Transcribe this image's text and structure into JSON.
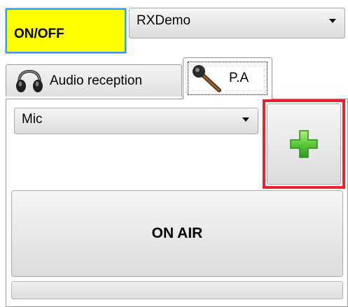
{
  "toolbar": {
    "onoff_label": "ON/OFF",
    "onoff_color": "#ffff00",
    "device_selected": "RXDemo"
  },
  "tabs": [
    {
      "label": "Audio reception",
      "icon": "headphones-icon",
      "active": false
    },
    {
      "label": "P.A",
      "icon": "microphone-icon",
      "active": true
    }
  ],
  "pa": {
    "source_selected": "Mic",
    "add_button_icon": "plus-icon",
    "add_highlight_color": "#e8232d",
    "onair_label": "ON AIR",
    "level": 0
  }
}
